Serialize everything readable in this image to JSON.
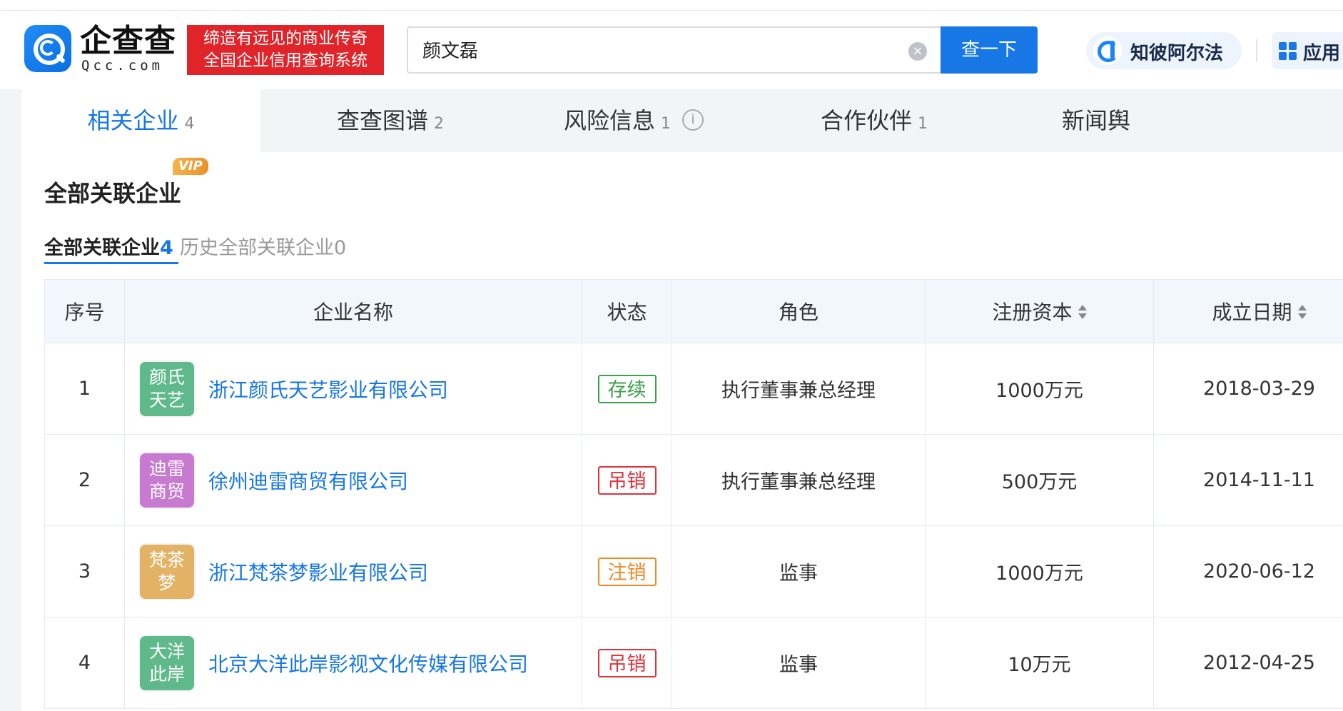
{
  "header": {
    "logo_text": "企查查",
    "logo_sub": "Qcc.com",
    "slogan_line1": "缔造有远见的商业传奇",
    "slogan_line2": "全国企业信用查询系统",
    "search_value": "颜文磊",
    "clear_icon_glyph": "×",
    "search_button": "查一下",
    "alpha_label": "知彼阿尔法",
    "apps_label": "应用"
  },
  "tabs": [
    {
      "label": "相关企业",
      "count": "4",
      "active": true
    },
    {
      "label": "查查图谱",
      "count": "2"
    },
    {
      "label": "风险信息",
      "count": "1",
      "info_glyph": "i"
    },
    {
      "label": "合作伙伴",
      "count": "1"
    },
    {
      "label": "新闻舆"
    }
  ],
  "section": {
    "title": "全部关联企业",
    "vip_badge": "VIP",
    "subtab_active_label": "全部关联企业",
    "subtab_active_count": "4",
    "subtab_inactive_label": "历史全部关联企业",
    "subtab_inactive_count": "0"
  },
  "table": {
    "headers": [
      "序号",
      "企业名称",
      "状态",
      "角色",
      "注册资本",
      "成立日期"
    ],
    "rows": [
      {
        "index": "1",
        "logo_line1": "颜氏",
        "logo_line2": "天艺",
        "logo_color": "#5fb98a",
        "name": "浙江颜氏天艺影业有限公司",
        "status": "存续",
        "status_color": "#3ca14a",
        "role": "执行董事兼总经理",
        "capital": "1000万元",
        "date": "2018-03-29"
      },
      {
        "index": "2",
        "logo_line1": "迪雷",
        "logo_line2": "商贸",
        "logo_color": "#c77ad0",
        "name": "徐州迪雷商贸有限公司",
        "status": "吊销",
        "status_color": "#e0323a",
        "role": "执行董事兼总经理",
        "capital": "500万元",
        "date": "2014-11-11"
      },
      {
        "index": "3",
        "logo_line1": "梵茶",
        "logo_line2": "梦",
        "logo_color": "#e3b265",
        "name": "浙江梵茶梦影业有限公司",
        "status": "注销",
        "status_color": "#f08a24",
        "role": "监事",
        "capital": "1000万元",
        "date": "2020-06-12"
      },
      {
        "index": "4",
        "logo_line1": "大洋",
        "logo_line2": "此岸",
        "logo_color": "#5fb98a",
        "name": "北京大洋此岸影视文化传媒有限公司",
        "status": "吊销",
        "status_color": "#e0323a",
        "role": "监事",
        "capital": "10万元",
        "date": "2012-04-25"
      }
    ]
  },
  "colors": {
    "brand": "#1677e5",
    "slogan_bg": "#e0242a",
    "header_bg": "#f2f7fd"
  },
  "icons": [
    "qcc-logo-icon",
    "clear-icon",
    "alpha-logo-icon",
    "apps-grid-icon",
    "info-icon",
    "sort-icon"
  ]
}
